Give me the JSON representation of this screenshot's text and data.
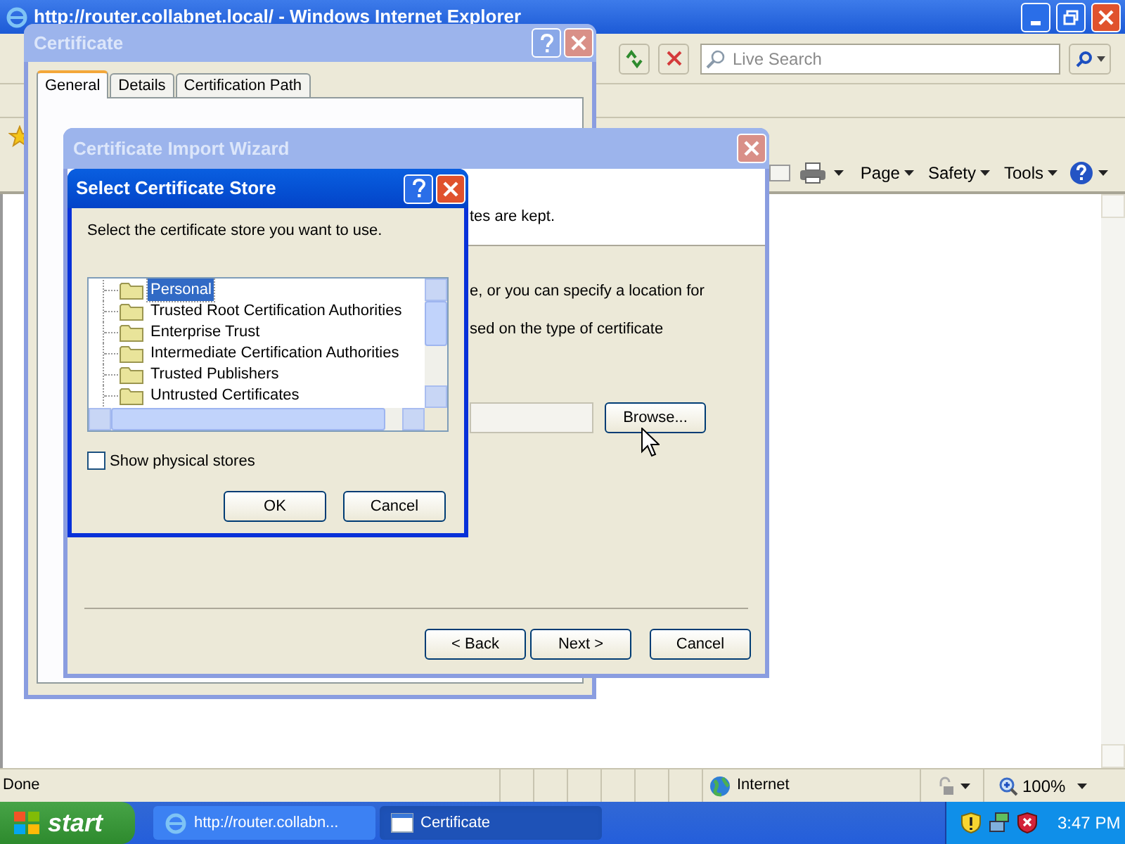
{
  "browser": {
    "title": "http://router.collabnet.local/ - Windows Internet Explorer",
    "search": {
      "placeholder": "Live Search"
    },
    "commands": [
      "Page",
      "Safety",
      "Tools"
    ],
    "status_bar": {
      "status": "Done",
      "zone": "Internet",
      "zoom": "100%"
    }
  },
  "certificate_dialog": {
    "title": "Certificate",
    "tabs": [
      {
        "label": "General",
        "selected": true
      },
      {
        "label": "Details",
        "selected": false
      },
      {
        "label": "Certification Path",
        "selected": false
      }
    ]
  },
  "import_wizard": {
    "title": "Certificate Import Wizard",
    "text_fragments": [
      "tes are kept.",
      "e, or you can specify a location for",
      "sed on the type of certificate"
    ],
    "browse_button": "Browse...",
    "buttons": [
      "< Back",
      "Next >",
      "Cancel"
    ]
  },
  "store_dialog": {
    "title": "Select Certificate Store",
    "instruction": "Select the certificate store you want to use.",
    "stores": [
      {
        "label": "Personal",
        "selected": true
      },
      {
        "label": "Trusted Root Certification Authorities",
        "selected": false
      },
      {
        "label": "Enterprise Trust",
        "selected": false
      },
      {
        "label": "Intermediate Certification Authorities",
        "selected": false
      },
      {
        "label": "Trusted Publishers",
        "selected": false
      },
      {
        "label": "Untrusted Certificates",
        "selected": false
      }
    ],
    "show_physical_stores": {
      "label": "Show physical stores",
      "checked": false
    },
    "buttons": [
      "OK",
      "Cancel"
    ]
  },
  "taskbar": {
    "start": "start",
    "tasks": [
      {
        "kind": "browser",
        "label": "http://router.collabn...",
        "selected": false
      },
      {
        "kind": "window",
        "label": "Certificate",
        "selected": true
      }
    ],
    "clock": "3:47 PM"
  }
}
